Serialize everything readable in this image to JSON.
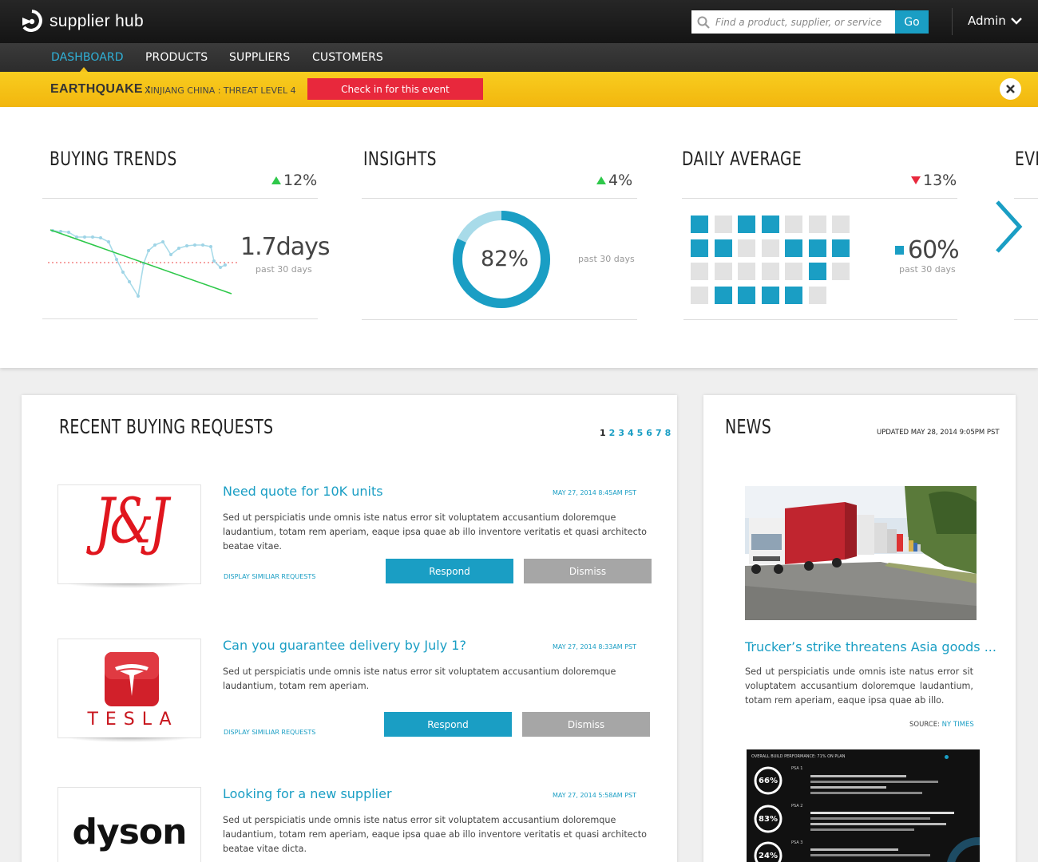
{
  "app": {
    "name": "supplier hub"
  },
  "search": {
    "placeholder": "Find a product, supplier, or service",
    "button": "Go"
  },
  "user": {
    "label": "Admin"
  },
  "nav": [
    {
      "label": "DASHBOARD",
      "active": true
    },
    {
      "label": "PRODUCTS"
    },
    {
      "label": "SUPPLIERS"
    },
    {
      "label": "CUSTOMERS"
    }
  ],
  "alert": {
    "title": "EARTHQUAKE :",
    "detail": "XINJIANG CHINA : THREAT LEVEL 4",
    "button": "Check in for this event"
  },
  "stats": {
    "buying_trends": {
      "title": "BUYING TRENDS",
      "change": "12%",
      "direction": "up",
      "value": "1.7",
      "unit": "days",
      "note": "past 30 days"
    },
    "insights": {
      "title": "INSIGHTS",
      "change": "4%",
      "direction": "up",
      "value": "82%",
      "percent": 82,
      "note": "past 30 days"
    },
    "daily_average": {
      "title": "DAILY AVERAGE",
      "change": "13%",
      "direction": "down",
      "value": "60%",
      "note": "past 30 days",
      "grid": [
        [
          1,
          0,
          1,
          1,
          0,
          0,
          0
        ],
        [
          1,
          1,
          0,
          0,
          1,
          1,
          1
        ],
        [
          0,
          0,
          0,
          0,
          0,
          1,
          0
        ],
        [
          0,
          1,
          1,
          1,
          1,
          0
        ]
      ]
    },
    "next_partial_title": "EVE"
  },
  "requests": {
    "title": "RECENT BUYING REQUESTS",
    "pages": [
      "1",
      "2",
      "3",
      "4",
      "5",
      "6",
      "7",
      "8"
    ],
    "current_page": "1",
    "items": [
      {
        "logo": "J&J",
        "title": "Need quote for 10K units",
        "date": "MAY 27, 2014 8:45AM PST",
        "body": "Sed ut perspiciatis unde omnis iste natus error sit voluptatem accusantium doloremque laudantium, totam rem aperiam, eaque ipsa quae ab illo inventore veritatis et quasi architecto beatae vitae.",
        "similar": "DISPLAY SIMILIAR REQUESTS",
        "respond": "Respond",
        "dismiss": "Dismiss"
      },
      {
        "logo": "TESLA",
        "title": "Can you guarantee delivery by July 1?",
        "date": "MAY 27, 2014 8:33AM PST",
        "body": "Sed ut perspiciatis unde omnis iste natus error sit voluptatem accusantium doloremque laudantium, totam rem aperiam.",
        "similar": "DISPLAY SIMILIAR REQUESTS",
        "respond": "Respond",
        "dismiss": "Dismiss"
      },
      {
        "logo": "dyson",
        "title": "Looking for a new supplier",
        "date": "MAY 27, 2014 5:58AM PST",
        "body": "Sed ut perspiciatis unde omnis iste natus error sit voluptatem accusantium doloremque laudantium, totam rem aperiam, eaque ipsa quae ab illo inventore veritatis et quasi architecto beatae vitae dicta."
      }
    ]
  },
  "news": {
    "title": "NEWS",
    "updated": "UPDATED MAY 28, 2014 9:05PM PST",
    "headline": "Trucker’s strike threatens Asia goods ...",
    "body": "Sed ut perspiciatis unde omnis iste natus error sit voluptatem accusantium doloremque laudantium, totam rem aperiam, eaque ipsa quae ab illo.",
    "source_label": "SOURCE:",
    "source_name": "NY TIMES",
    "dashboard_title": "OVERALL BUILD PERFORMANCE: 71% ON PLAN",
    "dashboard_rings": [
      "66%",
      "83%",
      "24%"
    ],
    "dashboard_psa": [
      "PSA 1",
      "PSA 2",
      "PSA 3"
    ]
  },
  "colors": {
    "accent": "#1a9ec4",
    "alert": "#f6c21a",
    "danger": "#e8283c",
    "up": "#2ec84a"
  }
}
